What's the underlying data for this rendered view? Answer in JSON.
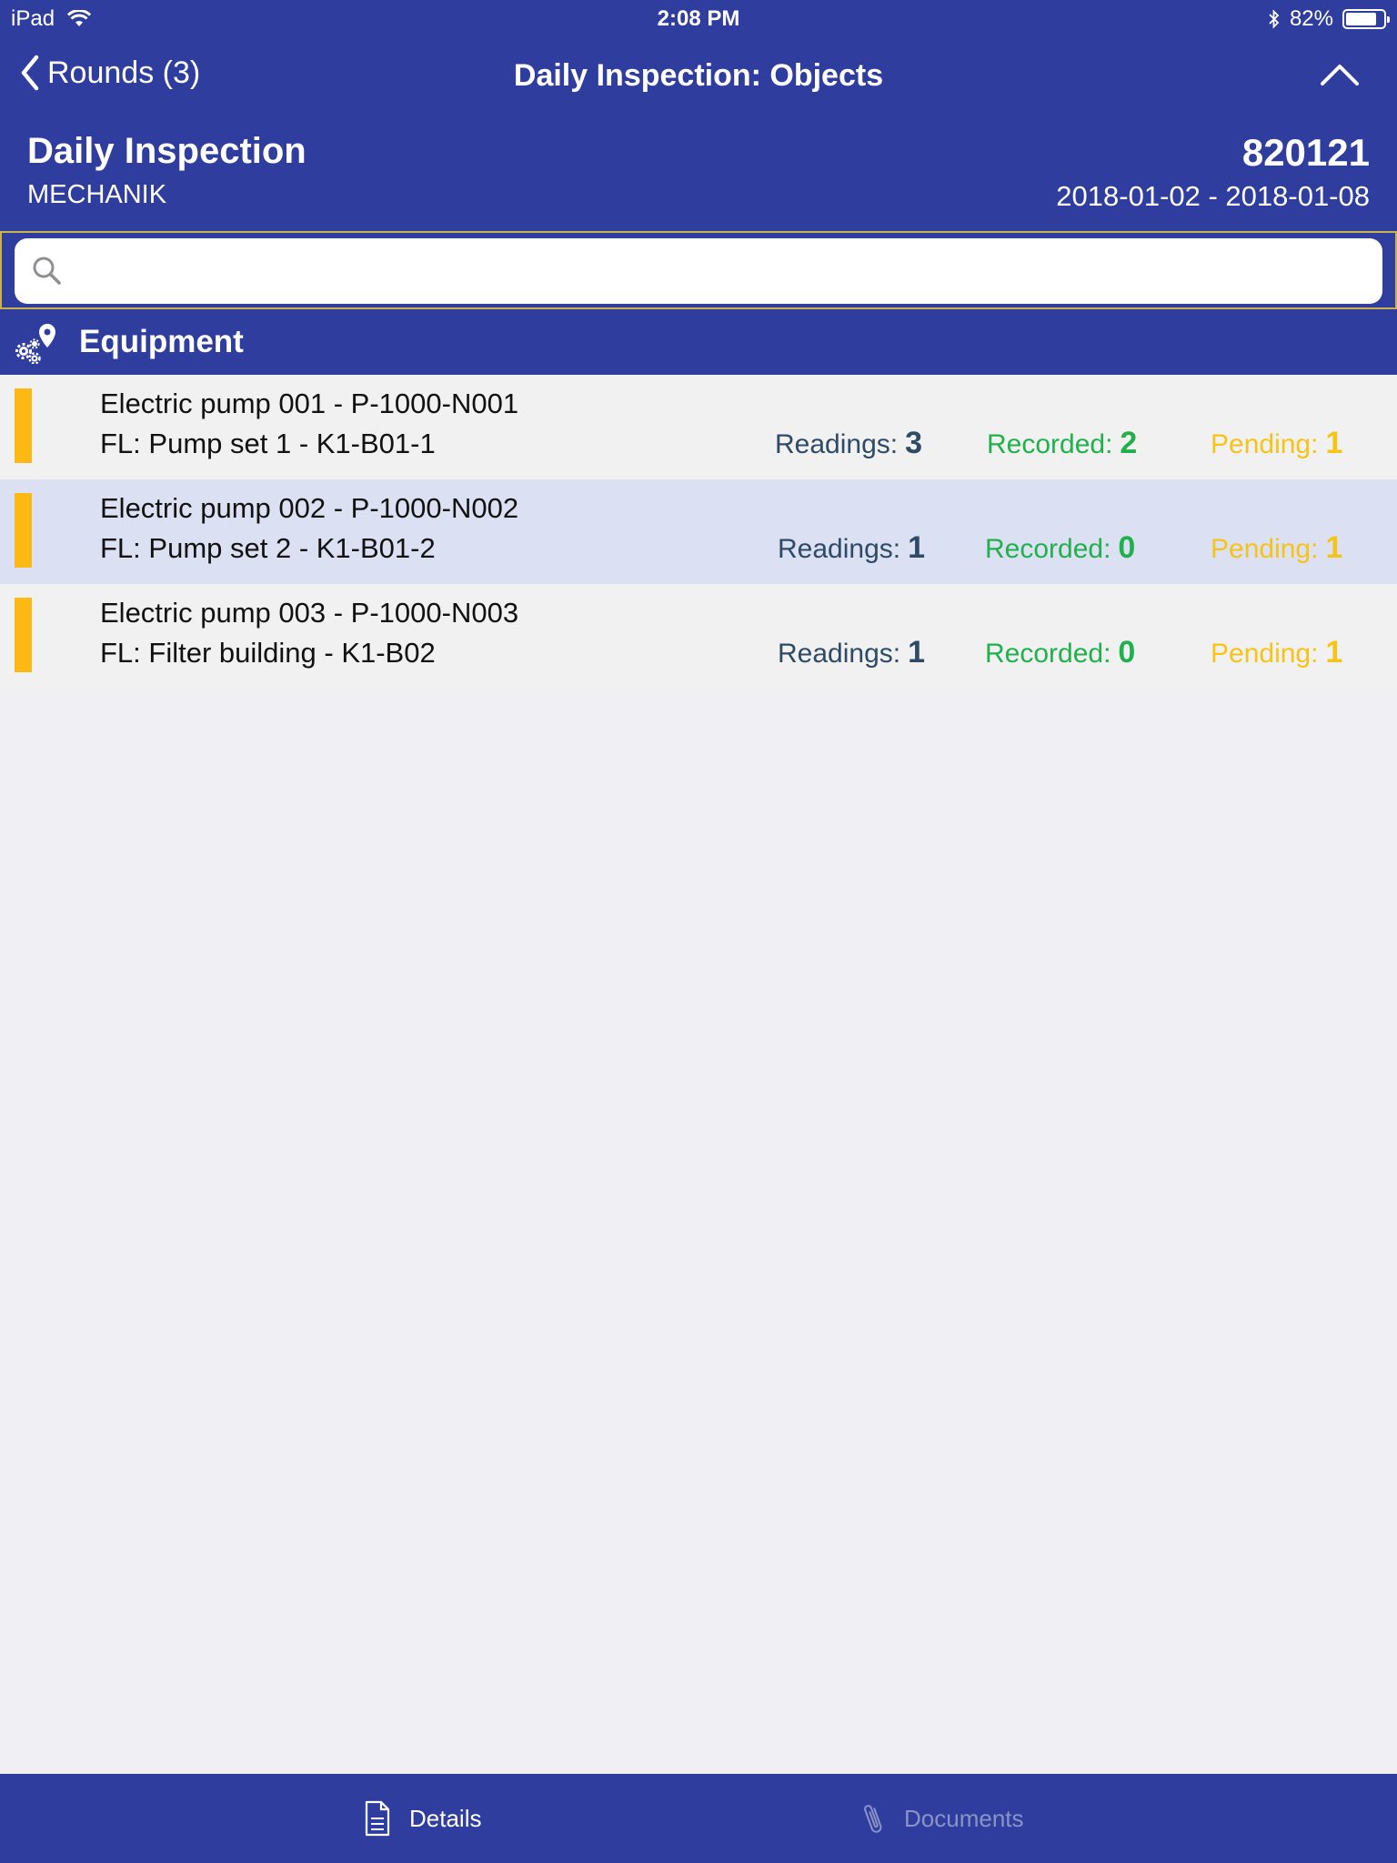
{
  "status_bar": {
    "device": "iPad",
    "time": "2:08 PM",
    "battery": "82%",
    "battery_level": 0.82
  },
  "nav": {
    "back_label": "Rounds (3)",
    "title": "Daily Inspection: Objects"
  },
  "header": {
    "title": "Daily Inspection",
    "subtitle": "MECHANIK",
    "number": "820121",
    "date_range": "2018-01-02 - 2018-01-08"
  },
  "search": {
    "value": "",
    "placeholder": ""
  },
  "section": {
    "title": "Equipment"
  },
  "labels": {
    "readings": "Readings:",
    "recorded": "Recorded:",
    "pending": "Pending:"
  },
  "items": [
    {
      "name": "Electric pump 001 - P-1000-N001",
      "location": "FL: Pump set 1 - K1-B01-1",
      "readings": "3",
      "recorded": "2",
      "pending": "1"
    },
    {
      "name": "Electric pump 002 - P-1000-N002",
      "location": "FL: Pump set 2 - K1-B01-2",
      "readings": "1",
      "recorded": "0",
      "pending": "1"
    },
    {
      "name": "Electric pump 003 - P-1000-N003",
      "location": "FL: Filter building - K1-B02",
      "readings": "1",
      "recorded": "0",
      "pending": "1"
    }
  ],
  "tabs": {
    "details": "Details",
    "documents": "Documents"
  },
  "colors": {
    "primary": "#2f3e9e",
    "status_pending": "#fdb913",
    "readings": "#2e4a66",
    "recorded": "#21b14c",
    "pending": "#f8c317",
    "selected_row": "#dbe1f3"
  }
}
